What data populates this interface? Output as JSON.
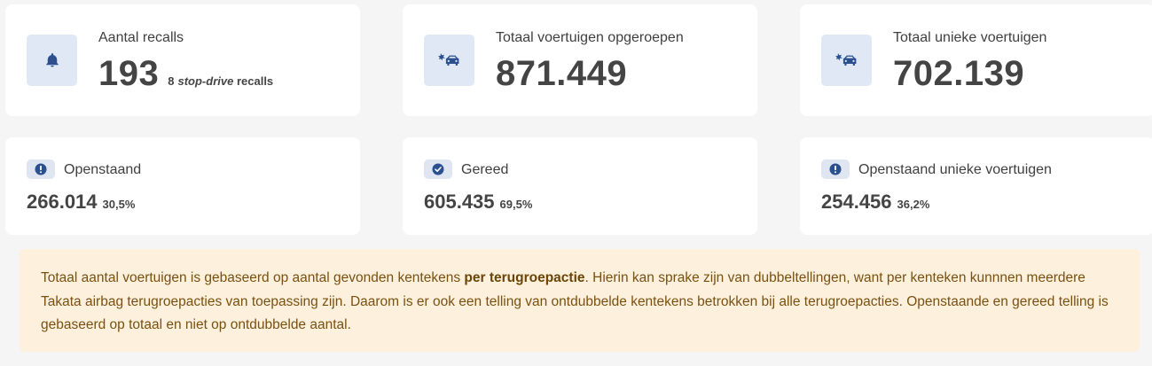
{
  "stats_top": [
    {
      "label": "Aantal recalls",
      "value": "193",
      "sub_count": "8",
      "sub_em": "stop-drive",
      "sub_tail": "recalls",
      "icon": "bell-icon"
    },
    {
      "label": "Totaal voertuigen opgeroepen",
      "value": "871.449",
      "icon": "car-crash-icon"
    },
    {
      "label": "Totaal unieke voertuigen",
      "value": "702.139",
      "icon": "car-crash-icon"
    }
  ],
  "stats_bottom": [
    {
      "label": "Openstaand",
      "value": "266.014",
      "percent": "30,5%",
      "icon": "exclamation-circle-icon"
    },
    {
      "label": "Gereed",
      "value": "605.435",
      "percent": "69,5%",
      "icon": "check-circle-icon"
    },
    {
      "label": "Openstaand unieke voertuigen",
      "value": "254.456",
      "percent": "36,2%",
      "icon": "exclamation-circle-icon"
    }
  ],
  "notice": {
    "text_before": "Totaal aantal voertuigen is gebaseerd op aantal gevonden kentekens ",
    "bold": "per terugroepactie",
    "text_after": ". Hierin kan sprake zijn van dubbeltellingen, want per kenteken kunnnen meerdere Takata airbag terugroepacties van toepassing zijn. Daarom is er ook een telling van ontdubbelde kentekens betrokken bij alle terugroepacties. Openstaande en gereed telling is gebaseerd op totaal en niet op ontdubbelde aantal."
  },
  "colors": {
    "icon": "#2b4f8f",
    "icon_bg": "#e1e8f5",
    "notice_bg": "#fdf0dc",
    "notice_text": "#7a5111"
  }
}
